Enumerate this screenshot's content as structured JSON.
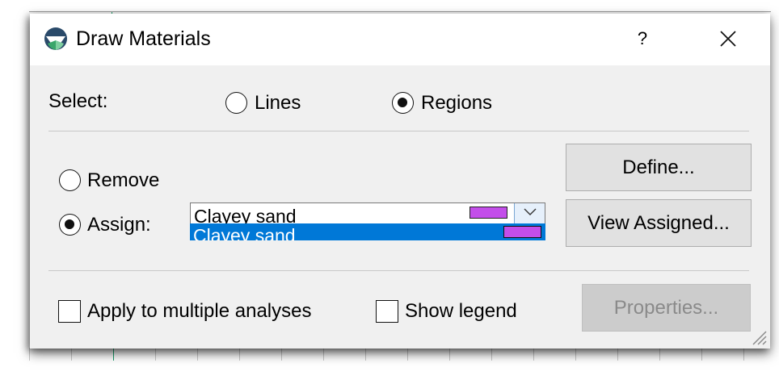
{
  "window": {
    "title": "Draw Materials",
    "help_label": "?",
    "close_label": "✕"
  },
  "select": {
    "label": "Select:",
    "options": [
      {
        "label": "Lines",
        "checked": false
      },
      {
        "label": "Regions",
        "checked": true
      }
    ]
  },
  "mode": {
    "remove_label": "Remove",
    "remove_checked": false,
    "assign_label": "Assign:",
    "assign_checked": true
  },
  "material": {
    "selected": "Clayey sand",
    "selected_color": "#c34eea",
    "dropdown_highlight": "Clayey sand",
    "dropdown_highlight_color": "#c34eea"
  },
  "buttons": {
    "define": "Define...",
    "view_assigned": "View Assigned...",
    "properties": "Properties..."
  },
  "options": {
    "apply_multiple_label": "Apply to multiple analyses",
    "apply_multiple_checked": false,
    "show_legend_label": "Show legend",
    "show_legend_checked": false
  },
  "colors": {
    "accent": "#0078d7",
    "dialog_bg": "#f0f0f0",
    "button_bg": "#e1e1e1"
  }
}
